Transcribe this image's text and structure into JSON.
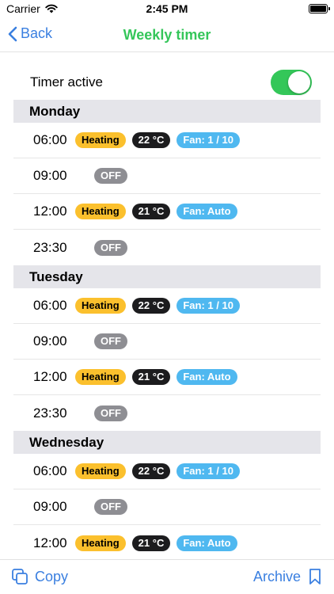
{
  "status_bar": {
    "carrier": "Carrier",
    "time": "2:45 PM"
  },
  "nav": {
    "back_label": "Back",
    "title": "Weekly timer"
  },
  "timer": {
    "label": "Timer active",
    "enabled": true
  },
  "days": [
    {
      "name": "Monday",
      "entries": [
        {
          "time": "06:00",
          "mode": "Heating",
          "temp": "22 °C",
          "fan": "Fan: 1 / 10"
        },
        {
          "time": "09:00",
          "mode": "OFF"
        },
        {
          "time": "12:00",
          "mode": "Heating",
          "temp": "21 °C",
          "fan": "Fan: Auto"
        },
        {
          "time": "23:30",
          "mode": "OFF"
        }
      ]
    },
    {
      "name": "Tuesday",
      "entries": [
        {
          "time": "06:00",
          "mode": "Heating",
          "temp": "22 °C",
          "fan": "Fan: 1 / 10"
        },
        {
          "time": "09:00",
          "mode": "OFF"
        },
        {
          "time": "12:00",
          "mode": "Heating",
          "temp": "21 °C",
          "fan": "Fan: Auto"
        },
        {
          "time": "23:30",
          "mode": "OFF"
        }
      ]
    },
    {
      "name": "Wednesday",
      "entries": [
        {
          "time": "06:00",
          "mode": "Heating",
          "temp": "22 °C",
          "fan": "Fan: 1 / 10"
        },
        {
          "time": "09:00",
          "mode": "OFF"
        },
        {
          "time": "12:00",
          "mode": "Heating",
          "temp": "21 °C",
          "fan": "Fan: Auto"
        }
      ]
    }
  ],
  "toolbar": {
    "copy_label": "Copy",
    "archive_label": "Archive"
  },
  "colors": {
    "accent": "#3a7fe0",
    "title": "#35c65a",
    "heating": "#fbc02d",
    "temp": "#1c1c1e",
    "fan": "#4fb8f0",
    "off": "#8e8e93"
  },
  "icons": {
    "wifi": "wifi-icon",
    "battery": "battery-icon",
    "back": "chevron-left-icon",
    "copy": "copy-icon",
    "archive": "bookmark-icon"
  }
}
